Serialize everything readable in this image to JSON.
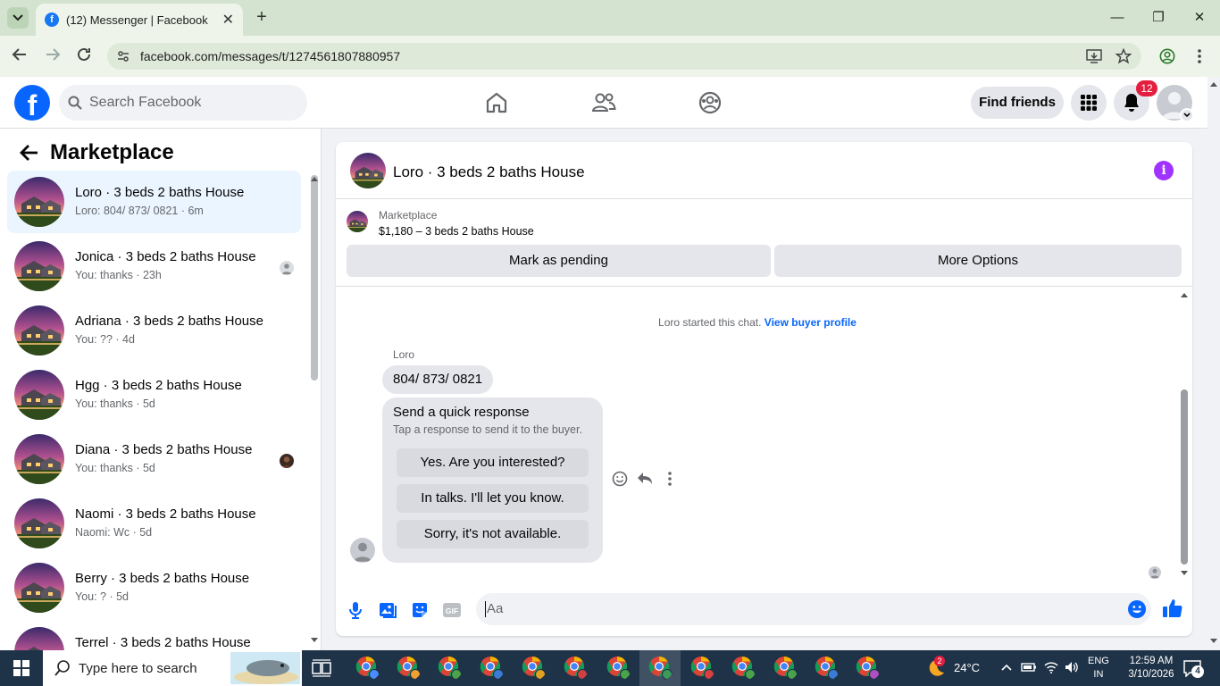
{
  "browser": {
    "tab_title": "(12) Messenger | Facebook",
    "url": "facebook.com/messages/t/1274561807880957"
  },
  "header": {
    "search_placeholder": "Search Facebook",
    "find_friends": "Find friends",
    "notification_count": "12"
  },
  "sidebar": {
    "title": "Marketplace",
    "conversations": [
      {
        "name": "Loro · 3 beds 2 baths House",
        "sub": "Loro: 804/ 873/ 0821 · 6m"
      },
      {
        "name": "Jonica · 3 beds 2 baths House",
        "sub": "You: thanks · 23h"
      },
      {
        "name": "Adriana · 3 beds 2 baths House",
        "sub": "You: ?? · 4d"
      },
      {
        "name": "Hgg · 3 beds 2 baths House",
        "sub": "You: thanks · 5d"
      },
      {
        "name": "Diana · 3 beds 2 baths House",
        "sub": "You: thanks · 5d"
      },
      {
        "name": "Naomi · 3 beds 2 baths House",
        "sub": "Naomi: Wc · 5d"
      },
      {
        "name": "Berry · 3 beds 2 baths House",
        "sub": "You: ? · 5d"
      },
      {
        "name": "Terrel · 3 beds 2 baths House",
        "sub": ""
      }
    ]
  },
  "chat": {
    "title": "Loro · 3 beds 2 baths House",
    "listing_kind": "Marketplace",
    "listing_price": "$1,180 – 3 beds 2 baths House",
    "mark_pending": "Mark as pending",
    "more_options": "More Options",
    "started_text": "Loro started this chat.",
    "view_buyer_profile": "View buyer profile",
    "sender": "Loro",
    "message": "804/ 873/ 0821",
    "quick_title": "Send a quick response",
    "quick_sub": "Tap a response to send it to the buyer.",
    "quick_responses": [
      "Yes. Are you interested?",
      "In talks. I'll let you know.",
      "Sorry, it's not available."
    ],
    "composer_placeholder": "Aa"
  },
  "taskbar": {
    "search_placeholder": "Type here to search",
    "temperature": "24°C",
    "lang1": "ENG",
    "lang2": "IN",
    "time": "12:59 AM",
    "date": "3/10/2026",
    "weather_badge": "2",
    "notif_count": "4"
  }
}
